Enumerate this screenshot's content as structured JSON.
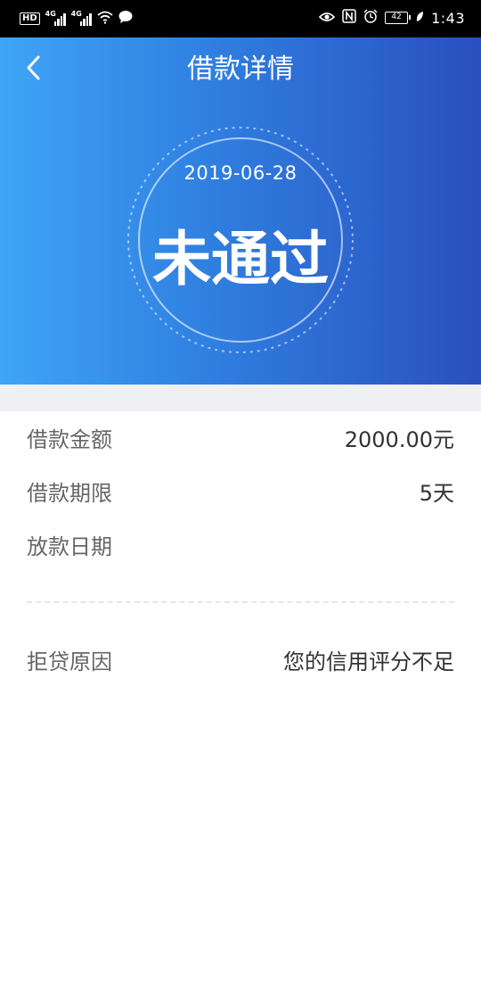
{
  "status_bar": {
    "hd": "HD",
    "sim1": "4G",
    "sim2": "4G",
    "battery": "42",
    "time": "1:43",
    "icons": [
      "wifi-icon",
      "chat-bubble-icon",
      "eye-icon",
      "nfc-icon",
      "alarm-icon",
      "leaf-icon"
    ]
  },
  "header": {
    "back_icon": "chevron-left-icon",
    "title": "借款详情"
  },
  "stamp": {
    "date": "2019-06-28",
    "status": "未通过"
  },
  "details": [
    {
      "label": "借款金额",
      "value": "2000.00元"
    },
    {
      "label": "借款期限",
      "value": "5天"
    },
    {
      "label": "放款日期",
      "value": ""
    }
  ],
  "reject": {
    "label": "拒贷原因",
    "value": "您的信用评分不足"
  },
  "colors": {
    "hero_start": "#3fa5f6",
    "hero_end": "#2a4fbe",
    "label_text": "#666666",
    "value_text": "#333333",
    "band": "#eef0f4"
  }
}
